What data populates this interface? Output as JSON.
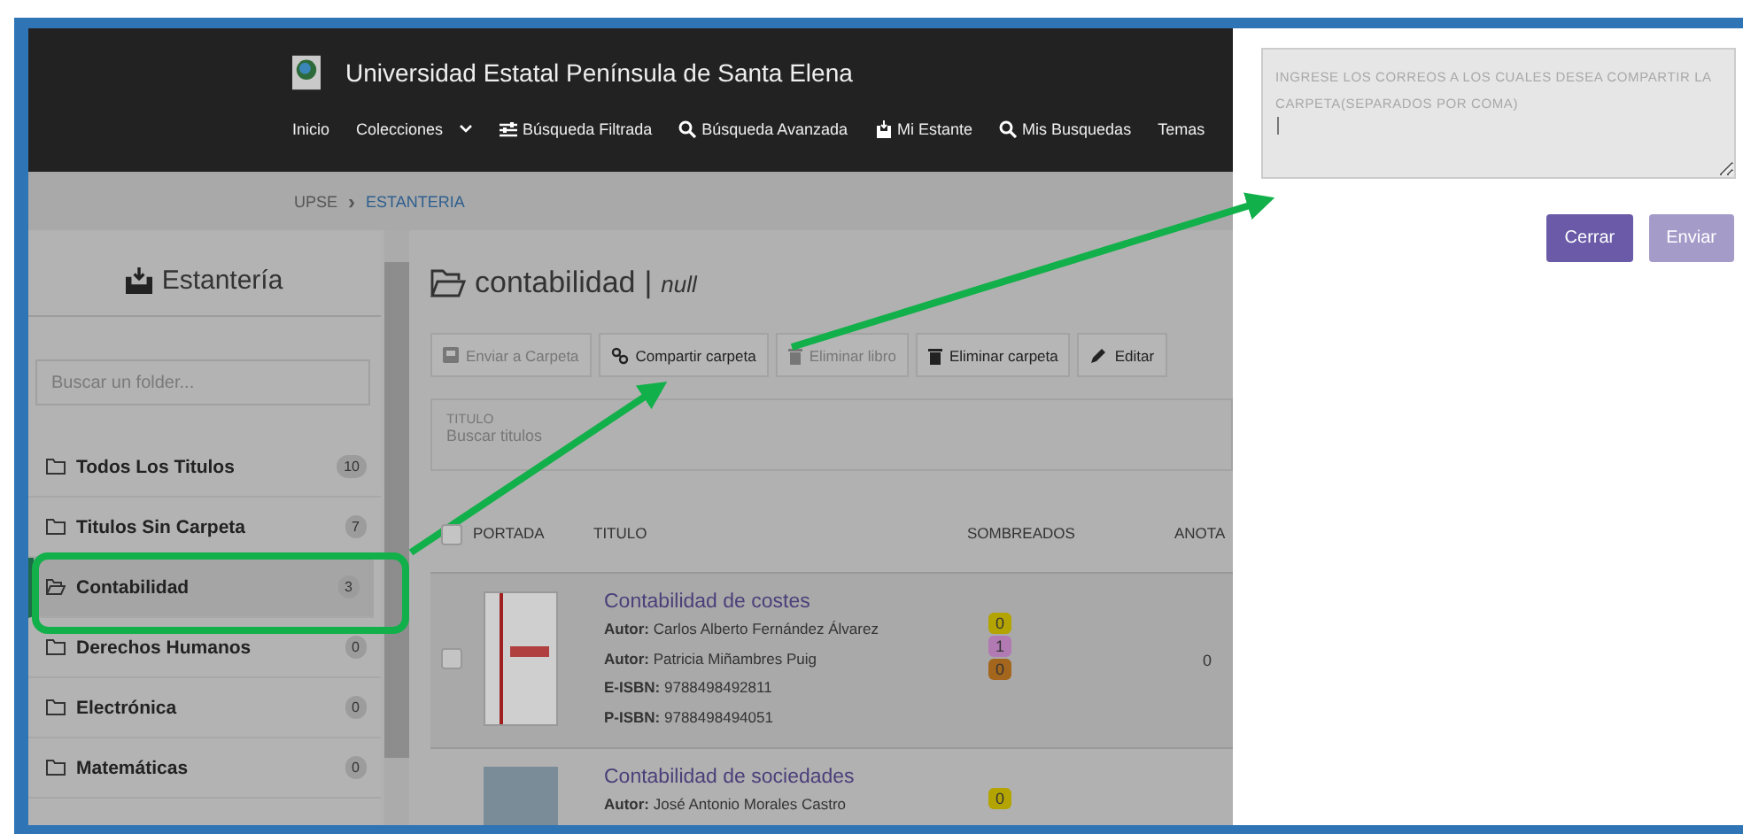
{
  "header": {
    "title": "Universidad Estatal Península de Santa Elena",
    "nav": [
      {
        "label": "Inicio",
        "kind": "plain"
      },
      {
        "label": "Colecciones",
        "kind": "dropdown"
      },
      {
        "label": "Búsqueda Filtrada",
        "kind": "sliders"
      },
      {
        "label": "Búsqueda Avanzada",
        "kind": "search"
      },
      {
        "label": "Mi Estante",
        "kind": "inbox"
      },
      {
        "label": "Mis Busquedas",
        "kind": "search"
      },
      {
        "label": "Temas",
        "kind": "plain"
      }
    ]
  },
  "breadcrumb": {
    "separator": "›",
    "items": [
      {
        "label": "UPSE",
        "selected": false
      },
      {
        "label": "ESTANTERIA",
        "selected": true
      }
    ]
  },
  "sidebar": {
    "title": "Estantería",
    "search": {
      "placeholder": "Buscar un folder..."
    },
    "folders": [
      {
        "label": "Todos Los Titulos",
        "count": "10",
        "selected": false
      },
      {
        "label": "Titulos Sin Carpeta",
        "count": "7",
        "selected": false
      },
      {
        "label": "Contabilidad",
        "count": "3",
        "selected": true
      },
      {
        "label": "Derechos Humanos",
        "count": "0",
        "selected": false
      },
      {
        "label": "Electrónica",
        "count": "0",
        "selected": false
      },
      {
        "label": "Matemáticas",
        "count": "0",
        "selected": false
      }
    ]
  },
  "main": {
    "folder": "contabilidad",
    "divider": "|",
    "subtitle": "null",
    "actions": [
      {
        "label": "Enviar a Carpeta",
        "kind": "send",
        "disabled": true
      },
      {
        "label": "Compartir carpeta",
        "kind": "link",
        "disabled": false
      },
      {
        "label": "Eliminar libro",
        "kind": "trash",
        "disabled": true
      },
      {
        "label": "Eliminar carpeta",
        "kind": "trash",
        "disabled": false
      },
      {
        "label": "Editar",
        "kind": "pencil",
        "disabled": false
      }
    ],
    "filter": {
      "label": "TITULO",
      "placeholder": "Buscar titulos"
    },
    "table": {
      "all_checked": false,
      "columns": [
        "PORTADA",
        "TITULO",
        "SOMBREADOS",
        "ANOTA"
      ],
      "rows": [
        {
          "checked": false,
          "kind": "book",
          "title": "Contabilidad de costes",
          "fields": [
            {
              "label": "Autor:",
              "value": "Carlos Alberto Fernández Álvarez"
            },
            {
              "label": "Autor:",
              "value": "Patricia Miñambres Puig"
            },
            {
              "label": "E-ISBN:",
              "value": "9788498492811"
            },
            {
              "label": "P-ISBN:",
              "value": "9788498494051"
            }
          ],
          "highlights": [
            {
              "count": "0",
              "color": "#b3a400"
            },
            {
              "count": "1",
              "color": "#b27ab3"
            },
            {
              "count": "0",
              "color": "#a4661c"
            }
          ],
          "annotations": "0"
        },
        {
          "kind": "photo",
          "title": "Contabilidad de sociedades",
          "fields": [
            {
              "label": "Autor:",
              "value": "José Antonio Morales Castro"
            }
          ],
          "highlights": [
            {
              "count": "0",
              "color": "#b3a400"
            }
          ]
        }
      ]
    }
  },
  "share": {
    "placeholder": "INGRESE LOS CORREOS A LOS CUALES DESEA COMPARTIR LA CARPETA(SEPARADOS POR COMA)",
    "buttons": [
      {
        "label": "Cerrar",
        "disabled": false
      },
      {
        "label": "Enviar",
        "disabled": true
      }
    ]
  }
}
